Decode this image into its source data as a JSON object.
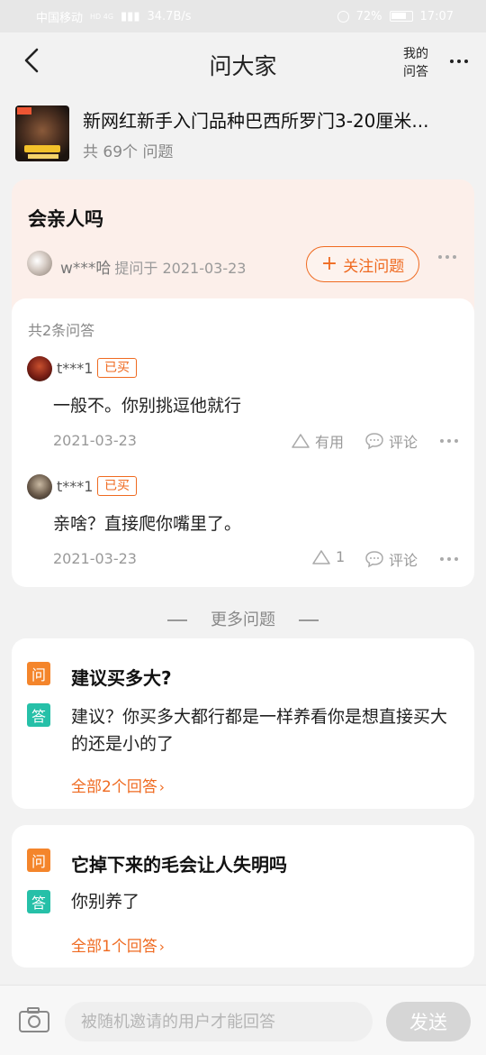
{
  "status_bar": {
    "carrier": "中国移动",
    "network": "HD 4G",
    "speed": "34.7B/s",
    "battery": "72%",
    "time": "17:07"
  },
  "header": {
    "title": "问大家",
    "my_answers_line1": "我的",
    "my_answers_line2": "问答"
  },
  "product": {
    "name": "新网红新手入门品种巴西所罗门3-20厘米...",
    "question_count": "共 69个 问题"
  },
  "question": {
    "title": "会亲人吗",
    "asker": "w***哈",
    "asked_on": "提问于 2021-03-23",
    "follow_label": "关注问题",
    "follow_plus": "+"
  },
  "answers": {
    "total_label": "共2条问答",
    "items": [
      {
        "user": "t***1",
        "badge": "已买",
        "text": "一般不。你别挑逗他就行",
        "date": "2021-03-23",
        "useful_label": "有用",
        "comment_label": "评论"
      },
      {
        "user": "t***1",
        "badge": "已买",
        "text": "亲啥？直接爬你嘴里了。",
        "date": "2021-03-23",
        "useful_label": "1",
        "comment_label": "评论"
      }
    ]
  },
  "more_questions": {
    "label": "更多问题",
    "items": [
      {
        "q_badge": "问",
        "a_badge": "答",
        "question": "建议买多大?",
        "answer": "建议？你买多大都行都是一样养看你是想直接买大的还是小的了",
        "all_answers": "全部2个回答"
      },
      {
        "q_badge": "问",
        "a_badge": "答",
        "question": "它掉下来的毛会让人失明吗",
        "answer": "你别养了",
        "all_answers": "全部1个回答"
      }
    ]
  },
  "bottom_bar": {
    "input_placeholder": "被随机邀请的用户才能回答",
    "send_label": "发送"
  },
  "colors": {
    "accent": "#ef6a20",
    "question_badge": "#f4852b",
    "answer_badge": "#26c0a8",
    "question_card_bg": "#fcefea"
  }
}
